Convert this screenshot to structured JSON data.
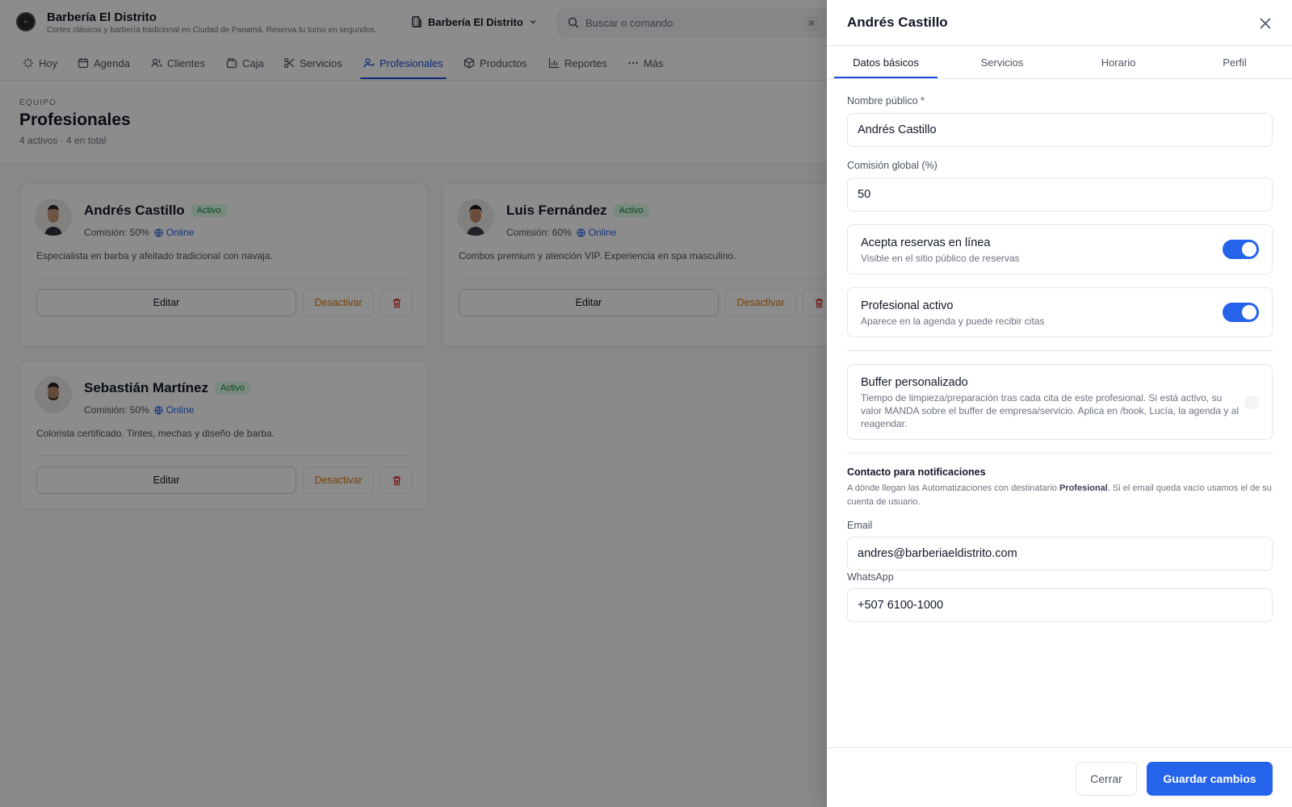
{
  "header": {
    "brand_name": "Barbería El Distrito",
    "brand_tagline": "Cortes clásicos y barbería tradicional en Ciudad de Panamá. Reserva tu turno en segundos.",
    "logo_icon": "barbershop-logo",
    "business_selector": "Barbería El Distrito",
    "search_placeholder": "Buscar o comando"
  },
  "nav": {
    "items": [
      {
        "label": "Hoy",
        "icon": "sparkle-icon"
      },
      {
        "label": "Agenda",
        "icon": "calendar-icon"
      },
      {
        "label": "Clientes",
        "icon": "users-icon"
      },
      {
        "label": "Caja",
        "icon": "cash-register-icon"
      },
      {
        "label": "Servicios",
        "icon": "scissors-icon"
      },
      {
        "label": "Profesionales",
        "icon": "team-icon"
      },
      {
        "label": "Productos",
        "icon": "box-icon"
      },
      {
        "label": "Reportes",
        "icon": "bar-chart-icon"
      },
      {
        "label": "Más",
        "icon": "more-icon"
      }
    ],
    "active": "Profesionales"
  },
  "page": {
    "eyebrow": "EQUIPO",
    "title": "Profesionales",
    "subtitle": "4 activos · 4 en total"
  },
  "professionals": [
    {
      "name": "Andrés Castillo",
      "status": "Activo",
      "commission": "Comisión: 50%",
      "channel": "Online",
      "description": "Especialista en barba y afeitado tradicional con navaja.",
      "edit_label": "Editar",
      "deactivate_label": "Desactivar"
    },
    {
      "name": "Luis Fernández",
      "status": "Activo",
      "commission": "Comisión: 60%",
      "channel": "Online",
      "description": "Combos premium y atención VIP. Experiencia en spa masculino.",
      "edit_label": "Editar",
      "deactivate_label": "Desactivar"
    },
    {
      "name": "Sebastián Martínez",
      "status": "Activo",
      "commission": "Comisión: 50%",
      "channel": "Online",
      "description": "Colorista certificado. Tintes, mechas y diseño de barba.",
      "edit_label": "Editar",
      "deactivate_label": "Desactivar"
    }
  ],
  "drawer": {
    "title": "Andrés Castillo",
    "tabs": [
      "Datos básicos",
      "Servicios",
      "Horario",
      "Perfil"
    ],
    "active_tab": "Datos básicos",
    "fields": {
      "public_name_label": "Nombre público *",
      "public_name_value": "Andrés Castillo",
      "commission_label": "Comisión global (%)",
      "commission_value": "50"
    },
    "toggles": [
      {
        "title": "Acepta reservas en línea",
        "description": "Visible en el sitio público de reservas",
        "on": true
      },
      {
        "title": "Profesional activo",
        "description": "Aparece en la agenda y puede recibir citas",
        "on": true
      },
      {
        "title": "Buffer personalizado",
        "description": "Tiempo de limpieza/preparación tras cada cita de este profesional. Si está activo, su valor MANDA sobre el buffer de empresa/servicio. Aplica en /book, Lucía, la agenda y al reagendar.",
        "on": false
      }
    ],
    "contact": {
      "section_title": "Contacto para notificaciones",
      "desc_before": "A dónde llegan las Automatizaciones con destinatario ",
      "desc_bold": "Profesional",
      "desc_after": ". Si el email queda vacío usamos el de su cuenta de usuario.",
      "email_label": "Email",
      "email_value": "andres@barberiaeldistrito.com",
      "whatsapp_label": "WhatsApp",
      "whatsapp_value": "+507 6100-1000"
    },
    "footer": {
      "close_label": "Cerrar",
      "save_label": "Guardar cambios"
    }
  },
  "colors": {
    "accent": "#2563eb",
    "active_badge_bg": "#dcfce7",
    "active_badge_text": "#15803d",
    "deactivate_text": "#d97706",
    "delete_icon": "#dc2626"
  }
}
